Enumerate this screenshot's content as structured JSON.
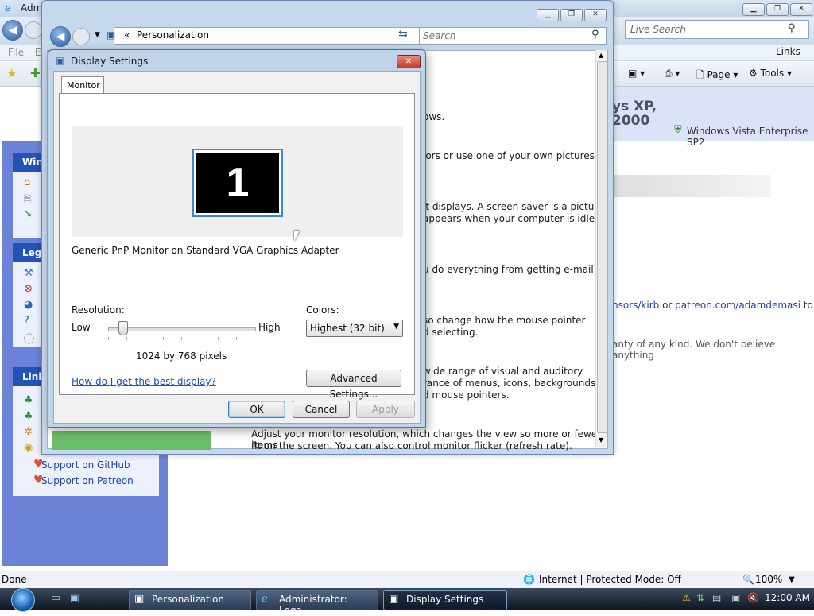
{
  "ie": {
    "title": "Adm",
    "search_placeholder": "Live Search",
    "menu": [
      "File",
      "E"
    ],
    "links": "Links",
    "cmd_page": "Page",
    "cmd_tools": "Tools",
    "banner_xp": "ys XP,",
    "banner_2000": "2000",
    "banner_vista": "Windows Vista Enterprise SP2",
    "side_head_1": "Win",
    "side_head_2": "Lega",
    "side_head_3": "Link",
    "side_links": [
      "Support on GitHub",
      "Support on Patreon"
    ],
    "credit_prefix": "nsors/kirb",
    "credit_or": " or ",
    "credit_patreon": "patreon.com/adamdemasi",
    "credit_to": " to",
    "warranty": "anty of any kind. We don't believe anything",
    "status": "Done",
    "zone": "Internet | Protected Mode: Off",
    "zoom": "100%"
  },
  "pers": {
    "breadcrumb_sep": "«",
    "address": "Personalization",
    "search_placeholder": "Search",
    "text_1": "ows.",
    "text_2": "lors or use one of your own pictures",
    "text_3a": "it displays. A screen saver is a picture",
    "text_3b": "appears when your computer is idle",
    "text_4": "u do everything from getting e-mail",
    "text_5a": "so change how the mouse pointer",
    "text_5b": "d selecting.",
    "text_6a": "wide range of visual and auditory",
    "text_6b": "rance of menus, icons, backgrounds,",
    "text_6c": "d mouse pointers.",
    "text_7a": "Adjust your monitor resolution, which changes the view so more or fewer items",
    "text_7b": "fit on the screen. You can also control monitor flicker (refresh rate)."
  },
  "dialog": {
    "title": "Display Settings",
    "tab": "Monitor",
    "monitor_number": "1",
    "monitor_name": "Generic PnP Monitor on Standard VGA Graphics Adapter",
    "resolution_label": "Resolution:",
    "low": "Low",
    "high": "High",
    "resolution_value": "1024 by 768 pixels",
    "colors_label": "Colors:",
    "colors_value": "Highest (32 bit)",
    "help_link": "How do I get the best display?",
    "advanced_button": "Advanced Settings...",
    "ok": "OK",
    "cancel": "Cancel",
    "apply": "Apply"
  },
  "taskbar": {
    "items": [
      "Personalization",
      "Administrator: Lega...",
      "Display Settings"
    ],
    "clock": "12:00 AM"
  }
}
